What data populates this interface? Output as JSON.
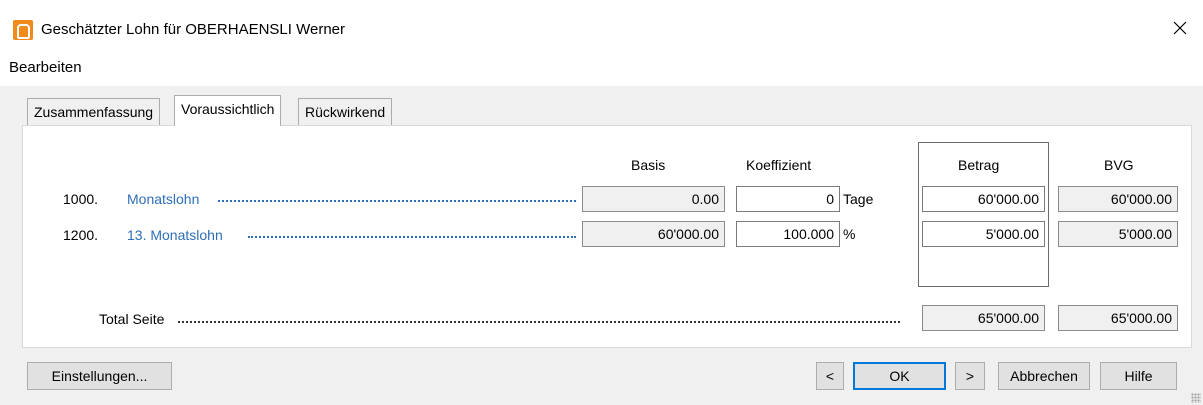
{
  "window": {
    "title": "Geschätzter Lohn für OBERHAENSLI Werner",
    "close_glyph": "✕",
    "app_icon": "app-logo-icon"
  },
  "menu": {
    "items": [
      "Bearbeiten"
    ]
  },
  "tabs": [
    {
      "label": "Zusammenfassung",
      "active": false
    },
    {
      "label": "Voraussichtlich",
      "active": true
    },
    {
      "label": "Rückwirkend",
      "active": false
    }
  ],
  "columns": {
    "basis": "Basis",
    "koeffizient": "Koeffizient",
    "betrag": "Betrag",
    "bvg": "BVG"
  },
  "rows": [
    {
      "code": "1000.",
      "name": "Monatslohn",
      "basis": "0.00",
      "koeffizient": "0",
      "unit": "Tage",
      "betrag": "60'000.00",
      "bvg": "60'000.00"
    },
    {
      "code": "1200.",
      "name": "13. Monatslohn",
      "basis": "60'000.00",
      "koeffizient": "100.000",
      "unit": "%",
      "betrag": "5'000.00",
      "bvg": "5'000.00"
    }
  ],
  "total": {
    "label": "Total Seite",
    "betrag": "65'000.00",
    "bvg": "65'000.00"
  },
  "buttons": {
    "settings": "Einstellungen...",
    "prev": "<",
    "ok": "OK",
    "next": ">",
    "cancel": "Abbrechen",
    "help": "Hilfe"
  },
  "colors": {
    "link": "#2f6fb8",
    "accent": "#0078d7",
    "app_icon": "#f08a1c"
  }
}
